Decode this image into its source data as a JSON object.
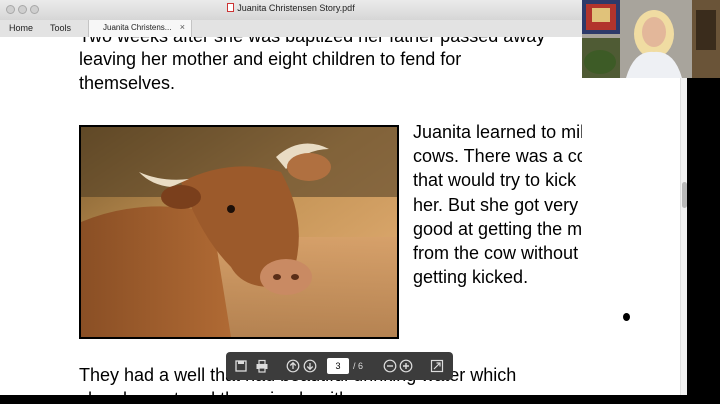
{
  "window": {
    "title": "Juanita Christensen Story.pdf"
  },
  "nav": {
    "home": "Home",
    "tools": "Tools"
  },
  "tab": {
    "label": "Juanita Christens...",
    "close": "×"
  },
  "document": {
    "line_top_partial": "Two weeks after she was baptized her father passed away",
    "line_1": "leaving her mother and eight children to fend for",
    "line_2": "themselves.",
    "side_text": "Juanita learned to milk cows. There was a cow that would try to kick her. But she got very good at getting the milk from the cow without getting kicked.",
    "line_bottom": " They had a well that had beautiful drinking water which",
    "line_bottom_partial": "she also watered the animals with"
  },
  "toolbar": {
    "current_page": "3",
    "total_pages": "/ 6",
    "icons": [
      "save-icon",
      "print-icon",
      "page-up-icon",
      "page-down-icon",
      "zoom-out-icon",
      "zoom-in-icon",
      "fit-page-icon"
    ]
  },
  "colors": {
    "toolbar_bg": "#3c3c3c",
    "page_bg": "#ffffff",
    "chrome_bg": "#e3e3e3"
  }
}
